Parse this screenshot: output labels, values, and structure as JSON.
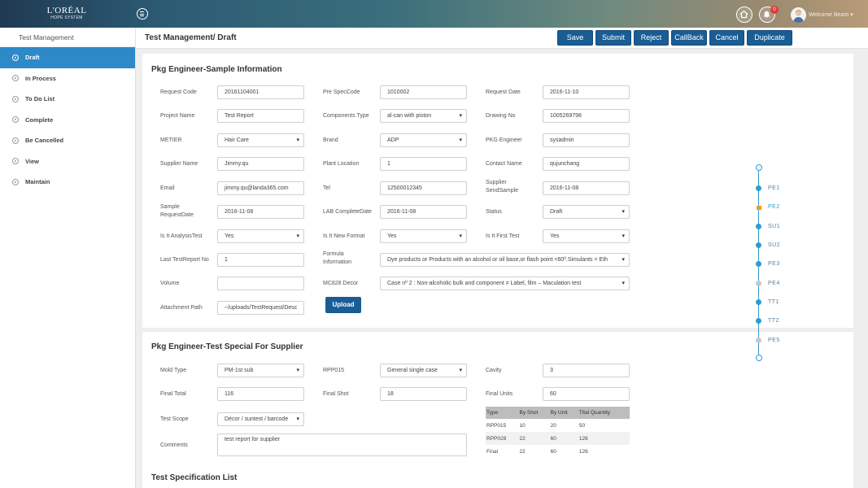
{
  "brand": {
    "logo_line1": "L'ORÉAL",
    "logo_line2": "HOPE SYSTEM"
  },
  "topbar": {
    "notification_count": "0",
    "welcome": "Welcome Beam"
  },
  "sidebar": {
    "title": "Test Management",
    "items": [
      {
        "label": "Draft",
        "active": true
      },
      {
        "label": "In Process"
      },
      {
        "label": "To Do List"
      },
      {
        "label": "Complete"
      },
      {
        "label": "Be Cancelled"
      },
      {
        "label": "View"
      },
      {
        "label": "Maintain"
      }
    ]
  },
  "page": {
    "title": "Test Management/ Draft",
    "buttons": [
      "Save",
      "Submit",
      "Reject",
      "CallBack",
      "Cancel",
      "Duplicate"
    ]
  },
  "sample_info": {
    "title": "Pkg Engineer-Sample Information",
    "request_code_label": "Request Code",
    "request_code": "20161104001",
    "pre_spec_code_label": "Pre SpecCode",
    "pre_spec_code": "1010002",
    "request_date_label": "Request Date",
    "request_date": "2016-11-10",
    "project_name_label": "Project Name",
    "project_name": "Test Report",
    "components_type_label": "Components Type",
    "components_type": "al-can with piston",
    "drawing_no_label": "Drawing No",
    "drawing_no": "1005269798",
    "metier_label": "METIER",
    "metier": "Hair Care",
    "brand_label": "Brand",
    "brand": "ADP",
    "pkg_engineer_label": "PKG Engineer",
    "pkg_engineer": "sysadmin",
    "supplier_name_label": "Supplier Name",
    "supplier_name": "Jimmy.qu",
    "plant_location_label": "Plant Location",
    "plant_location": "1",
    "contact_name_label": "Contact Name",
    "contact_name": "qujunchang",
    "email_label": "Email",
    "email": "jimmy.qu@landa365.com",
    "tel_label": "Tel",
    "tel": "12500012345",
    "supplier_send_label_1": "Supplier",
    "supplier_send_label_2": "SendSample",
    "supplier_send_sample": "2016-11-08",
    "sample_request_label_1": "Sample",
    "sample_request_label_2": "RequestDate",
    "sample_request_date": "2016-11-08",
    "lab_complete_label": "LAB CompleteDate",
    "lab_complete_date": "2016-11-08",
    "status_label": "Status",
    "status": "Draft",
    "analysis_test_label": "Is It AnalysisTest",
    "analysis_test": "Yes",
    "new_format_label": "Is It New Format",
    "new_format": "Yes",
    "first_test_label": "Is It First Test",
    "first_test": "Yes",
    "last_test_report_label": "Last TestReport No",
    "last_test_report": "1",
    "formula_label_1": "Formula",
    "formula_label_2": "Information",
    "formula": "Dye products or Products with an alcohol or oil base,or flash point <60º.Simulants = Eth",
    "volume_label": "Volume",
    "volume": "",
    "mc828_label": "MC828 Decor",
    "mc828": "Case nº 2 : Non-alcoholic bulk and component ≠ Label, film – Maculation test",
    "attachment_label": "Attachment Path",
    "attachment": "~/uploads/TestRequest/Desc",
    "upload_label": "Upload"
  },
  "special": {
    "title": "Pkg Engineer-Test Special For Supplier",
    "mold_type_label": "Mold Type",
    "mold_type": "PM-1st sub",
    "rpp015_label": "RPP015",
    "rpp015": "General single case",
    "cavity_label": "Cavity",
    "cavity": "3",
    "final_total_label": "Final Total",
    "final_total": "116",
    "final_shot_label": "Final Shot",
    "final_shot": "18",
    "final_units_label": "Final Units",
    "final_units": "60",
    "test_scope_label": "Test Scope",
    "test_scope": "Décor / suntest / barcode",
    "comments_label": "Comments",
    "comments": "test report for supplier",
    "table": {
      "headers": [
        "Type",
        "By Shot",
        "By Unit",
        "Tltal Quantity"
      ],
      "rows": [
        [
          "RPP015",
          "10",
          "20",
          "50"
        ],
        [
          "RPP028",
          "22",
          "60",
          "126"
        ],
        [
          "Final",
          "22",
          "60",
          "126"
        ]
      ]
    }
  },
  "spec_list": {
    "title": "Test Specification List"
  },
  "stepper": {
    "steps": [
      {
        "label": "PE1",
        "state": "done"
      },
      {
        "label": "PE2",
        "state": "current"
      },
      {
        "label": "SU1",
        "state": "done"
      },
      {
        "label": "SU2",
        "state": "done"
      },
      {
        "label": "PE3",
        "state": "done"
      },
      {
        "label": "PE4",
        "state": "pending"
      },
      {
        "label": "TT1",
        "state": "done"
      },
      {
        "label": "TT2",
        "state": "done"
      },
      {
        "label": "PE5",
        "state": "pending"
      }
    ]
  },
  "colors": {
    "primary": "#1a5d95",
    "active": "#2e89c8",
    "stepper": "#2f9bd4",
    "current_step": "#f39c12"
  }
}
